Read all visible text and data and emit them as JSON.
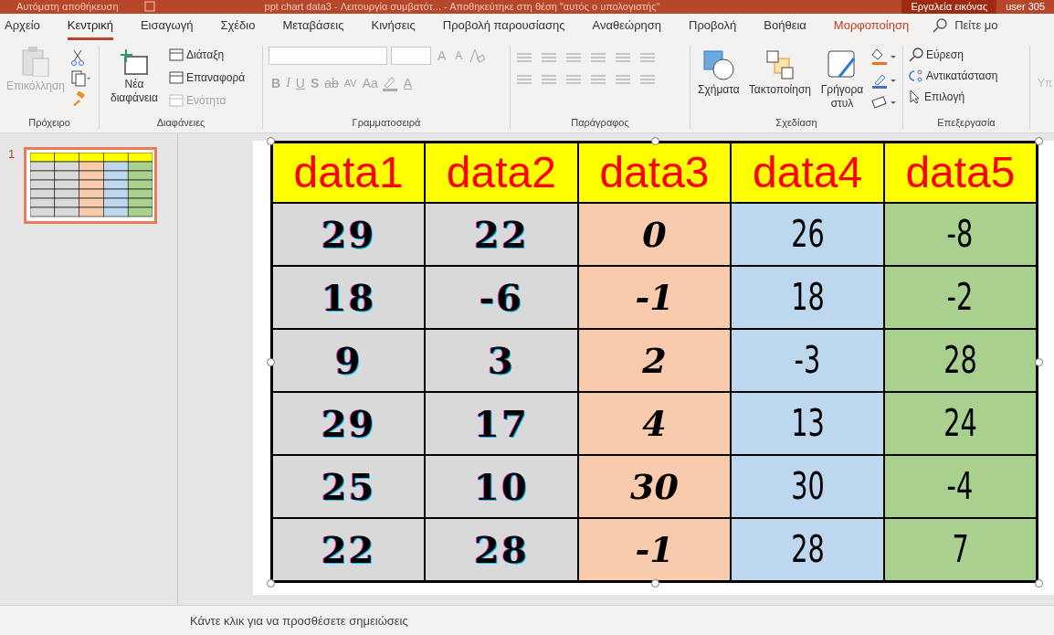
{
  "title_bar": {
    "autosave": "Αυτόματη αποθήκευση",
    "title": "ppt chart data3  -  Λειτουργία συμβατότ...  -  Αποθηκεύτηκε στη θέση \"αυτός ο υπολογιστής\"",
    "context": "Εργαλεία εικόνας",
    "user": "user 305"
  },
  "tabs": [
    {
      "label": "Αρχείο",
      "selected": false,
      "kind": "normal"
    },
    {
      "label": "Κεντρική",
      "selected": true,
      "kind": "normal"
    },
    {
      "label": "Εισαγωγή",
      "selected": false,
      "kind": "normal"
    },
    {
      "label": "Σχέδιο",
      "selected": false,
      "kind": "normal"
    },
    {
      "label": "Μεταβάσεις",
      "selected": false,
      "kind": "normal"
    },
    {
      "label": "Κινήσεις",
      "selected": false,
      "kind": "normal"
    },
    {
      "label": "Προβολή παρουσίασης",
      "selected": false,
      "kind": "normal"
    },
    {
      "label": "Αναθεώρηση",
      "selected": false,
      "kind": "normal"
    },
    {
      "label": "Προβολή",
      "selected": false,
      "kind": "normal"
    },
    {
      "label": "Βοήθεια",
      "selected": false,
      "kind": "normal"
    },
    {
      "label": "Μορφοποίηση",
      "selected": false,
      "kind": "contextual"
    }
  ],
  "tell_me": {
    "placeholder": "Πείτε μο"
  },
  "ribbon": {
    "groups": [
      {
        "label": "Πρόχειρο",
        "items": [
          {
            "label": "Επικόλληση",
            "disabled": true
          }
        ]
      },
      {
        "label": "Διαφάνειες",
        "items": [
          {
            "label": "Νέα διαφάνεια",
            "disabled": false
          },
          {
            "label": "Διάταξη",
            "disabled": false
          },
          {
            "label": "Επαναφορά",
            "disabled": false
          },
          {
            "label": "Ενότητα",
            "disabled": true
          }
        ]
      },
      {
        "label": "Γραμματοσειρά",
        "items": [
          {
            "label": "A",
            "disabled": true
          },
          {
            "label": "A",
            "disabled": true
          },
          {
            "label": "B",
            "disabled": true
          },
          {
            "label": "I",
            "disabled": true
          },
          {
            "label": "U",
            "disabled": true
          },
          {
            "label": "S",
            "disabled": true
          },
          {
            "label": "ab",
            "disabled": true
          },
          {
            "label": "AV",
            "disabled": true
          },
          {
            "label": "Aa",
            "disabled": true
          },
          {
            "label": "A",
            "disabled": true
          }
        ]
      },
      {
        "label": "Παράγραφος"
      },
      {
        "label": "Σχεδίαση",
        "items": [
          {
            "label": "Σχήματα",
            "disabled": false
          },
          {
            "label": "Τακτοποίηση",
            "disabled": false
          },
          {
            "label": "Γρήγορα στυλ",
            "disabled": false
          }
        ]
      },
      {
        "label": "Επεξεργασία",
        "items": [
          {
            "label": "Εύρεση",
            "disabled": false
          },
          {
            "label": "Αντικατάσταση",
            "disabled": false
          },
          {
            "label": "Επιλογή",
            "disabled": false
          }
        ]
      }
    ],
    "cut_group": "Υπ"
  },
  "thumbnails": [
    {
      "number": "1",
      "selected": true
    }
  ],
  "table": {
    "columns": [
      {
        "header": "data1",
        "color": "#d9d9d9",
        "kind": "engraved"
      },
      {
        "header": "data2",
        "color": "#d9d9d9",
        "kind": "engraved"
      },
      {
        "header": "data3",
        "color": "#f8cbad",
        "kind": "script"
      },
      {
        "header": "data4",
        "color": "#bdd7ee",
        "kind": "condensed"
      },
      {
        "header": "data5",
        "color": "#a9d08e",
        "kind": "condensed"
      }
    ],
    "rows": [
      [
        "29",
        "22",
        "0",
        "26",
        "-8"
      ],
      [
        "18",
        "-6",
        "-1",
        "18",
        "-2"
      ],
      [
        "9",
        "3",
        "2",
        "-3",
        "28"
      ],
      [
        "29",
        "17",
        "4",
        "13",
        "24"
      ],
      [
        "25",
        "10",
        "30",
        "30",
        "-4"
      ],
      [
        "22",
        "28",
        "-1",
        "28",
        "7"
      ]
    ]
  },
  "notes": {
    "placeholder": "Κάντε κλικ για να προσθέσετε σημειώσεις"
  }
}
